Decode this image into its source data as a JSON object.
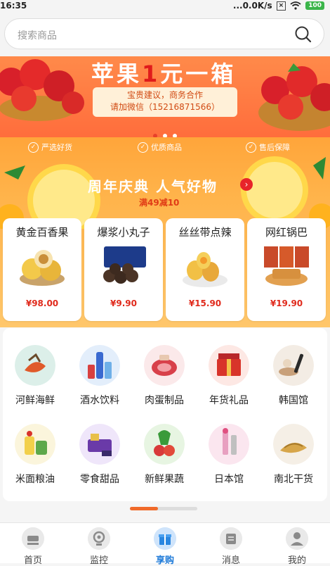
{
  "status_bar": {
    "time": "16:35",
    "speed": "...0.0K/s",
    "battery": "100"
  },
  "search": {
    "placeholder": "搜索商品"
  },
  "banner": {
    "title_a": "苹果",
    "title_one": "1",
    "title_b": "元一箱",
    "line1": "宝贵建议，商务合作",
    "line2": "请加微信（15216871566）",
    "carousel_pages": 3,
    "active_page": 1
  },
  "features": [
    "严选好货",
    "优质商品",
    "售后保障"
  ],
  "promo": {
    "headline": "周年庆典 人气好物",
    "arrow": "›",
    "sub": "满49减10"
  },
  "products": [
    {
      "name": "黄金百香果",
      "price": "¥98.00"
    },
    {
      "name": "爆浆小丸子",
      "price": "¥9.90"
    },
    {
      "name": "丝丝带点辣",
      "price": "¥15.90"
    },
    {
      "name": "网红锅巴",
      "price": "¥19.90"
    }
  ],
  "categories": [
    {
      "label": "河鲜海鲜"
    },
    {
      "label": "酒水饮料"
    },
    {
      "label": "肉蛋制品"
    },
    {
      "label": "年货礼品"
    },
    {
      "label": "韩国馆"
    },
    {
      "label": "米面粮油"
    },
    {
      "label": "零食甜品"
    },
    {
      "label": "新鲜果蔬"
    },
    {
      "label": "日本馆"
    },
    {
      "label": "南北干货"
    }
  ],
  "page_indicator": {
    "progress": 0.42
  },
  "nav": [
    {
      "label": "首页"
    },
    {
      "label": "监控"
    },
    {
      "label": "享购"
    },
    {
      "label": "消息"
    },
    {
      "label": "我的"
    }
  ],
  "colors": {
    "accent": "#f06a2a",
    "price": "#e02a1c",
    "nav_active": "#1e7ad8"
  }
}
